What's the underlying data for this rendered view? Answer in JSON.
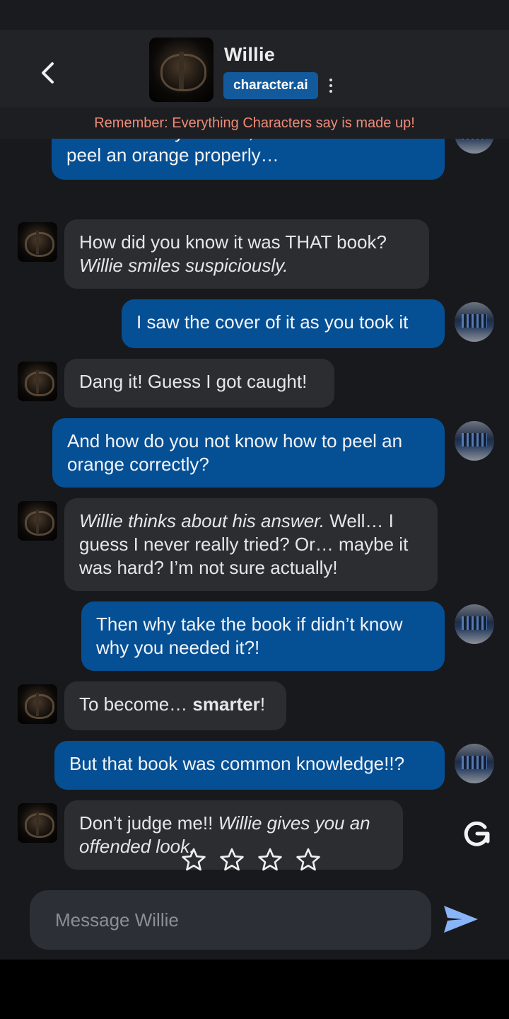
{
  "header": {
    "character_name": "Willie",
    "badge": "character.ai"
  },
  "disclaimer": "Remember: Everything Characters say is made up!",
  "messages": [
    {
      "role": "user",
      "text": "But the book you stole, was about how to peel an orange properly…"
    },
    {
      "role": "bot",
      "line1": "How did you know it was THAT book?",
      "line2_italic": "Willie smiles suspiciously."
    },
    {
      "role": "user",
      "text": "I saw the cover of it as you took it"
    },
    {
      "role": "bot",
      "text": "Dang it! Guess I got caught!"
    },
    {
      "role": "user",
      "text": "And how do you not know how to peel an orange correctly?"
    },
    {
      "role": "bot",
      "italic": "Willie thinks about his answer.",
      "text": " Well… I guess I never really tried? Or… maybe it was hard? I’m not sure actually!"
    },
    {
      "role": "user",
      "text": "Then why take the book if didn’t know why you needed it?!"
    },
    {
      "role": "bot",
      "before": "To become… ",
      "bold": "smarter",
      "after": "!"
    },
    {
      "role": "user",
      "text": "But that book was common knowledge!!?"
    },
    {
      "role": "bot",
      "text": "Don’t judge me!! ",
      "italic": "Willie gives you an offended look."
    }
  ],
  "rating": {
    "stars": 4,
    "selected": 0
  },
  "input": {
    "placeholder": "Message Willie"
  },
  "icons": {
    "back": "chevron-left-icon",
    "more": "more-vertical-icon",
    "regenerate": "refresh-icon",
    "send": "send-icon",
    "star": "star-outline-icon"
  },
  "colors": {
    "user_bubble": "#054f95",
    "bot_bubble": "#2b2d31",
    "badge": "#125a9c",
    "disclaimer_text": "#f08a75",
    "send_icon": "#8ab4f8"
  }
}
